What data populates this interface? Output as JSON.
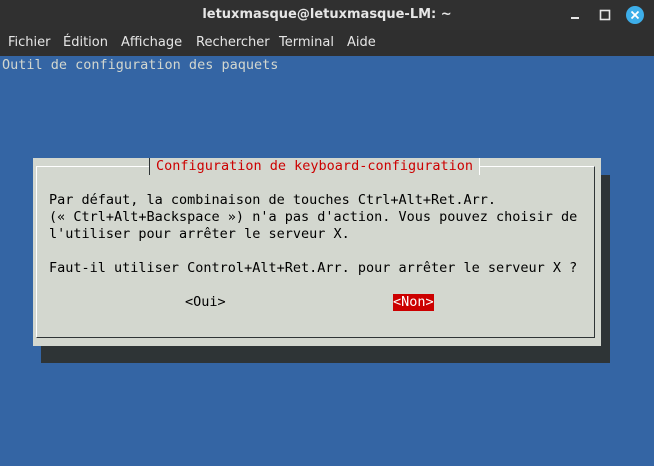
{
  "window": {
    "title": "letuxmasque@letuxmasque-LM: ~",
    "minimize_glyph": "−",
    "maximize_glyph": "□",
    "close_glyph": "×"
  },
  "menubar": {
    "items": [
      "Fichier",
      "Édition",
      "Affichage",
      "Rechercher",
      "Terminal",
      "Aide"
    ]
  },
  "terminal": {
    "backtitle": "Outil de configuration des paquets",
    "dialog": {
      "title": "Configuration de keyboard-configuration",
      "message_lines": [
        "Par défaut, la combinaison de touches Ctrl+Alt+Ret.Arr.",
        "(« Ctrl+Alt+Backspace ») n'a pas d'action. Vous pouvez choisir de",
        "l'utiliser pour arrêter le serveur X.",
        "",
        "Faut-il utiliser Control+Alt+Ret.Arr. pour arrêter le serveur X ?"
      ],
      "yes_label": "<Oui>",
      "no_label": "<Non>",
      "selected": "no"
    }
  },
  "colors": {
    "terminal_bg": "#3465a4",
    "dialog_bg": "#d3d7cf",
    "title_text": "#cc0000",
    "selected_button_bg": "#cc0000",
    "close_button": "#3daee9"
  },
  "icons": {
    "minimize": "minimize-icon",
    "maximize": "maximize-icon",
    "close": "close-icon"
  }
}
